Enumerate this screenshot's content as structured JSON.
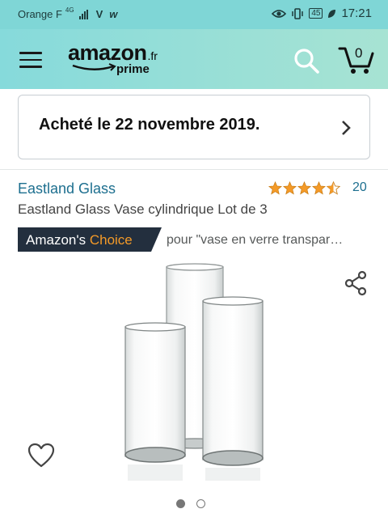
{
  "status_bar": {
    "carrier": "Orange F",
    "network": "4G",
    "time": "17:21",
    "battery": "45"
  },
  "header": {
    "logo_word": "amazon",
    "logo_tld": ".fr",
    "logo_sub": "prime",
    "cart_count": "0"
  },
  "order_notice": {
    "text": "Acheté le 22 novembre 2019."
  },
  "product": {
    "brand": "Eastland Glass",
    "title": "Eastland Glass Vase cylindrique Lot de 3",
    "rating_stars": 4.5,
    "review_count": "20",
    "badge_prefix": "Amazon's",
    "badge_choice": "Choice",
    "badge_context": "pour \"vase en verre transpar…"
  },
  "gallery": {
    "images_total": 2,
    "current_index": 1
  },
  "colors": {
    "header_teal": "#86dadb",
    "link_blue": "#1d6f8f",
    "star_orange": "#f49a28",
    "badge_navy": "#232f3e"
  },
  "icons": [
    "menu-icon",
    "search-icon",
    "cart-icon",
    "chevron-right-icon",
    "star-icon",
    "share-icon",
    "heart-icon"
  ]
}
